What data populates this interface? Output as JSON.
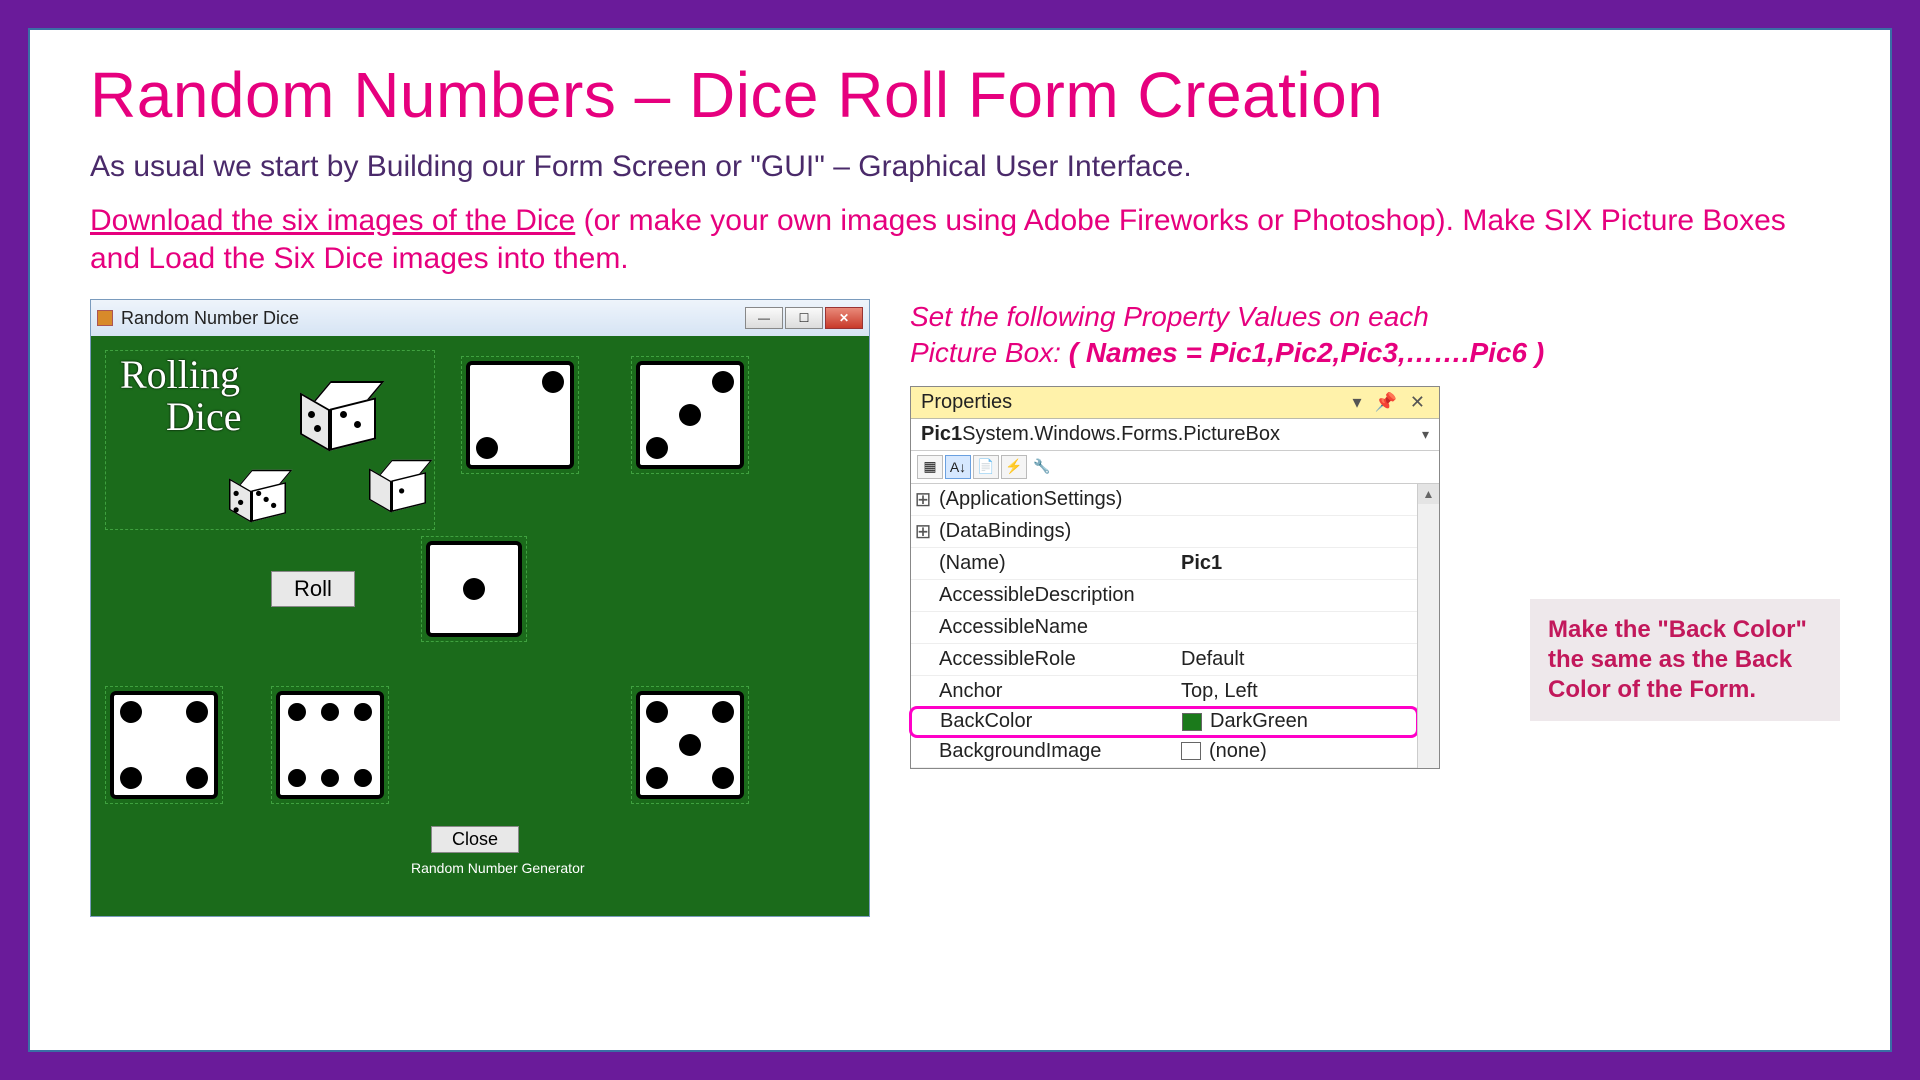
{
  "title": "Random Numbers – Dice Roll Form Creation",
  "subtitle": "As usual we start by Building our Form Screen or \"GUI\" – Graphical User Interface.",
  "paragraph_link": "Download the six images of the Dice",
  "paragraph_rest": " (or make your own images using Adobe Fireworks or Photoshop). Make SIX Picture Boxes and Load the Six Dice images into them.",
  "winform": {
    "title": "Random Number Dice",
    "logo_line1": "Rolling",
    "logo_line2": "Dice",
    "roll_button": "Roll",
    "close_button": "Close",
    "caption": "Random Number Generator"
  },
  "instruction": {
    "line1": "Set the following Property Values on each",
    "line2_prefix": "Picture Box:   ",
    "names": "( Names = Pic1,Pic2,Pic3,…….Pic6 )"
  },
  "properties": {
    "panel_title": "Properties",
    "object_name": "Pic1",
    "object_type": " System.Windows.Forms.PictureBox",
    "rows": [
      {
        "exp": "⊞",
        "key": "(ApplicationSettings)",
        "val": ""
      },
      {
        "exp": "⊞",
        "key": "(DataBindings)",
        "val": ""
      },
      {
        "exp": "",
        "key": "(Name)",
        "val": "Pic1",
        "bold": true
      },
      {
        "exp": "",
        "key": "AccessibleDescription",
        "val": ""
      },
      {
        "exp": "",
        "key": "AccessibleName",
        "val": ""
      },
      {
        "exp": "",
        "key": "AccessibleRole",
        "val": "Default"
      },
      {
        "exp": "",
        "key": "Anchor",
        "val": "Top, Left"
      },
      {
        "exp": "",
        "key": "BackColor",
        "val": "DarkGreen",
        "swatch": "#1b7a1b",
        "highlight": true
      },
      {
        "exp": "",
        "key": "BackgroundImage",
        "val": "(none)",
        "swatch": "#ffffff"
      }
    ]
  },
  "callout": "Make the \"Back Color\" the same as the Back Color of the Form."
}
